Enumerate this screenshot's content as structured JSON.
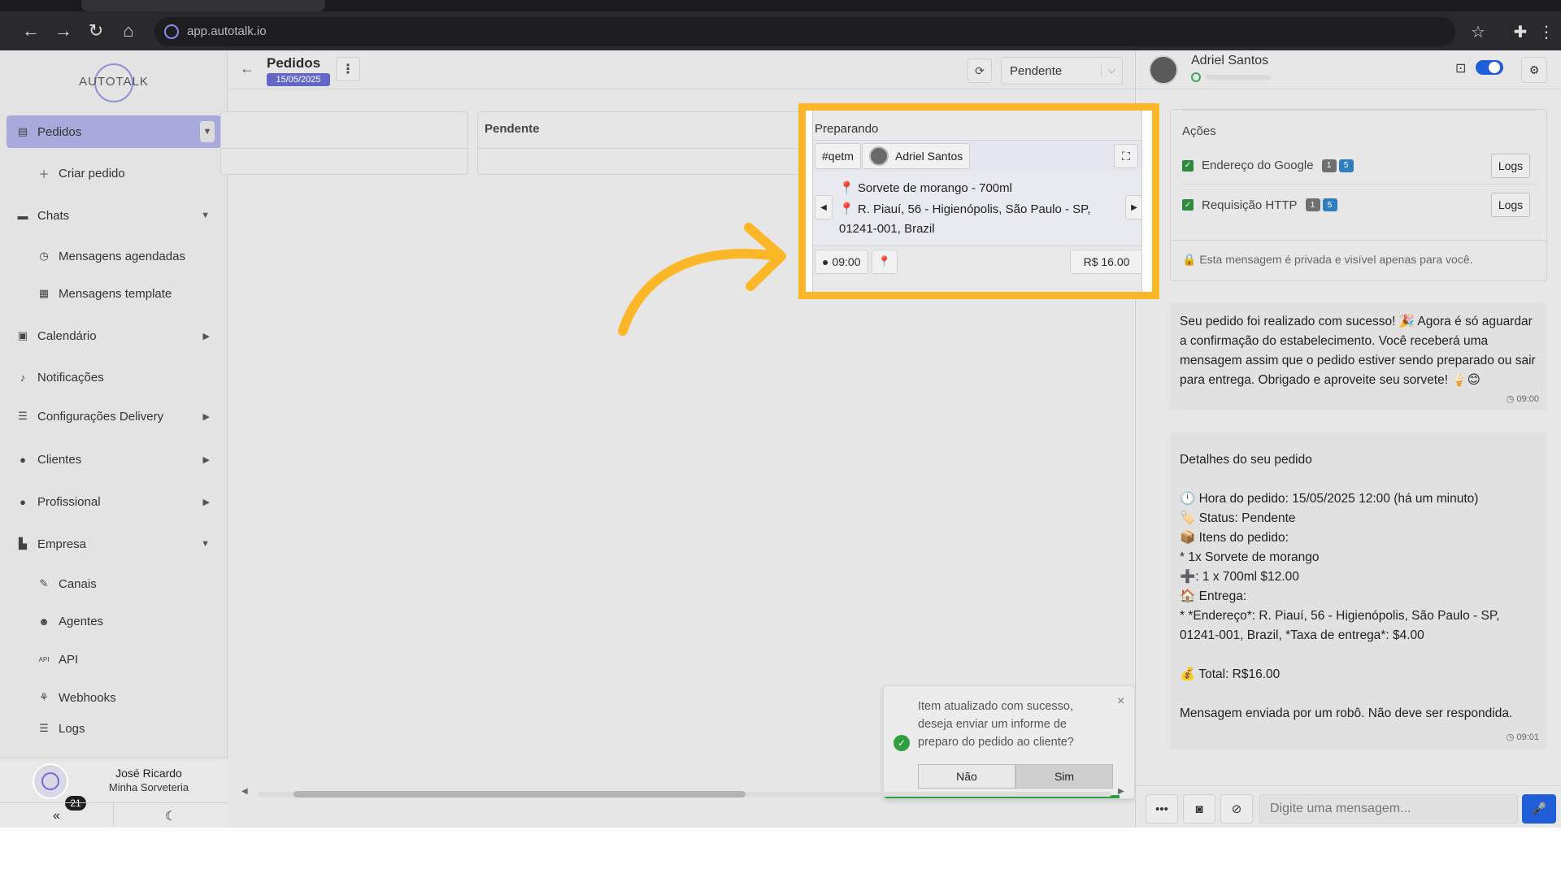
{
  "browser": {
    "url": "app.autotalk.io"
  },
  "sidebar": {
    "logo_text": "AUTOTALK",
    "items": [
      {
        "label": "Pedidos",
        "icon": "clipboard-icon"
      },
      {
        "label": "Criar pedido",
        "icon": "plus-icon"
      },
      {
        "label": "Chats",
        "icon": "chat-icon"
      },
      {
        "label": "Mensagens agendadas",
        "icon": "clock-icon"
      },
      {
        "label": "Mensagens template",
        "icon": "template-icon"
      },
      {
        "label": "Calendário",
        "icon": "calendar-icon"
      },
      {
        "label": "Notificações",
        "icon": "bell-icon"
      },
      {
        "label": "Configurações Delivery",
        "icon": "sliders-icon"
      },
      {
        "label": "Clientes",
        "icon": "users-icon"
      },
      {
        "label": "Profissional",
        "icon": "user-gear-icon"
      },
      {
        "label": "Empresa",
        "icon": "building-icon"
      },
      {
        "label": "Canais",
        "icon": "plug-icon"
      },
      {
        "label": "Agentes",
        "icon": "robot-icon"
      },
      {
        "label": "API",
        "icon": "api-icon"
      },
      {
        "label": "Webhooks",
        "icon": "webhook-icon"
      },
      {
        "label": "Logs",
        "icon": "list-icon"
      }
    ],
    "user": {
      "name": "José Ricardo",
      "company": "Minha Sorveteria",
      "badge": "21"
    }
  },
  "header": {
    "title": "Pedidos",
    "date": "15/05/2025",
    "status_select": "Pendente"
  },
  "board": {
    "columns": [
      {
        "title": ""
      },
      {
        "title": "Pendente"
      }
    ],
    "highlight": {
      "column_title": "Preparando",
      "order_code": "#qetm",
      "customer": "Adriel Santos",
      "item": "Sorvete de morango - 700ml",
      "address_line1": "R. Piauí, 56 - Higienópolis, São Paulo - SP,",
      "address_line2": "01241-001, Brazil",
      "time": "09:00",
      "price": "R$ 16.00"
    }
  },
  "toast": {
    "message": "Item atualizado com sucesso, deseja enviar um informe de preparo do pedido ao cliente?",
    "no_label": "Não",
    "yes_label": "Sim",
    "progress": 0.94
  },
  "chat": {
    "contact_name": "Adriel Santos",
    "actions_title": "Ações",
    "actions": [
      {
        "label": "Endereço do Google",
        "b1": "1",
        "b2": "5",
        "button": "Logs"
      },
      {
        "label": "Requisição HTTP",
        "b1": "1",
        "b2": "5",
        "button": "Logs"
      }
    ],
    "private_note": "Esta mensagem é privada e visível apenas para você.",
    "messages": [
      {
        "text": "Seu pedido foi realizado com sucesso! 🎉 Agora é só aguardar a confirmação do estabelecimento. Você receberá uma mensagem assim que o pedido estiver sendo preparado ou sair para entrega. Obrigado e aproveite seu sorvete! 🍦😊",
        "time": "09:00"
      },
      {
        "text": "Detalhes do seu pedido\n\n🕛 Hora do pedido: 15/05/2025 12:00 (há um minuto)\n🏷️ Status: Pendente\n📦 Itens do pedido:\n* 1x Sorvete de morango\n➕: 1 x 700ml $12.00\n🏠 Entrega:\n* *Endereço*: R. Piauí, 56 - Higienópolis, São Paulo - SP, 01241-001, Brazil, *Taxa de entrega*: $4.00\n\n💰 Total: R$16.00\n\nMensagem enviada por um robô. Não deve ser respondida.",
        "time": "09:01"
      }
    ],
    "composer_placeholder": "Digite uma mensagem..."
  },
  "colors": {
    "accent": "#6368c8",
    "highlight": "#fbb727",
    "primary_blue": "#1f5ed8",
    "success": "#2e9e3e"
  }
}
